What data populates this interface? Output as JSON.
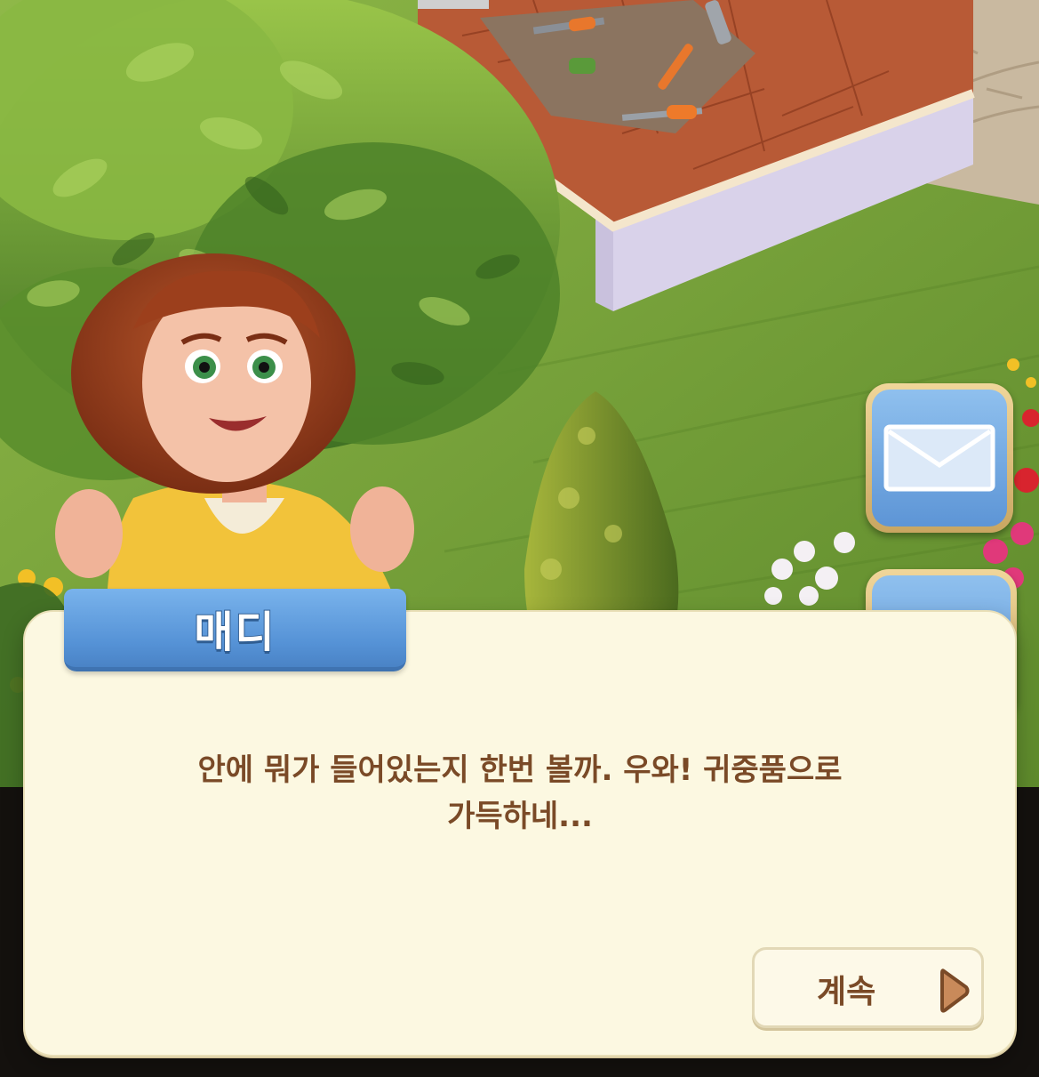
{
  "scene": {
    "icons": {
      "character": "character-madi-portrait",
      "tree": "tree-icon",
      "bush": "cone-bush-icon",
      "flowers": "flowers-icon",
      "tools": "tools-icon"
    }
  },
  "side_buttons": {
    "mail": {
      "icon": "envelope-icon"
    },
    "second": {
      "icon": "card-icon"
    }
  },
  "dialog": {
    "speaker": "매디",
    "lines": [
      "안에 뭐가 들어있는지 한번 볼까. 우와! 귀중품으로",
      "가득하네..."
    ],
    "continue_label": "계속",
    "continue_icon": "play-arrow-icon"
  },
  "colors": {
    "panel_bg": "#fcf8e1",
    "name_tag_blue": "#5592d6",
    "text_brown": "#7a4a27",
    "button_blue": "#6ba3e0",
    "button_gold": "#d9bb7a"
  }
}
